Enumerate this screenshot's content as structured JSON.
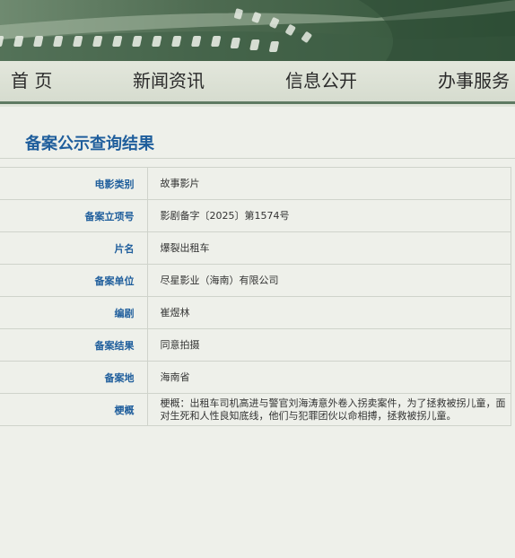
{
  "nav": {
    "items": [
      {
        "label": "首 页"
      },
      {
        "label": "新闻资讯"
      },
      {
        "label": "信息公开"
      },
      {
        "label": "办事服务"
      }
    ]
  },
  "result": {
    "title": "备案公示查询结果"
  },
  "record": {
    "rows": [
      {
        "label": "电影类别",
        "value": "故事影片"
      },
      {
        "label": "备案立项号",
        "value": "影剧备字〔2025〕第1574号"
      },
      {
        "label": "片名",
        "value": "爆裂出租车"
      },
      {
        "label": "备案单位",
        "value": "尽星影业（海南）有限公司"
      },
      {
        "label": "编剧",
        "value": "崔煜林"
      },
      {
        "label": "备案结果",
        "value": "同意拍摄"
      },
      {
        "label": "备案地",
        "value": "海南省"
      },
      {
        "label": "梗概",
        "value": "梗概：出租车司机高进与警官刘海涛意外卷入拐卖案件，为了拯救被拐儿童，面对生死和人性良知底线，他们与犯罪团伙以命相搏，拯救被拐儿童。"
      }
    ]
  },
  "colors": {
    "accent": "#1f5e9c",
    "banner": "#4e6b51",
    "nav_border": "#5e7a62"
  }
}
